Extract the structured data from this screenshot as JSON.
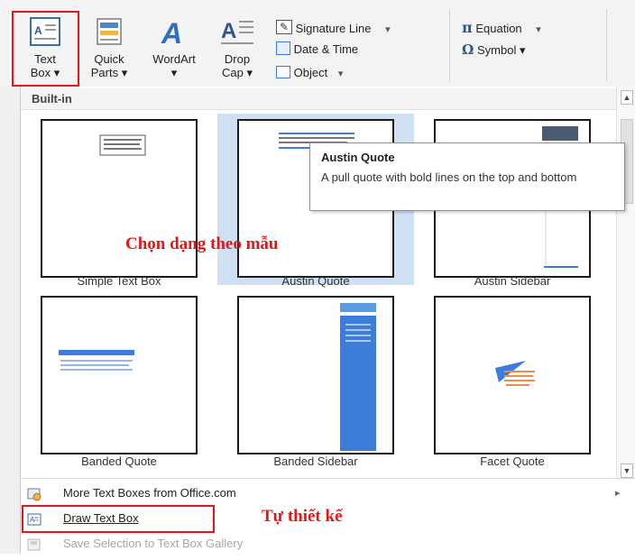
{
  "ribbon": {
    "text_box": {
      "line1": "Text",
      "line2": "Box ▾"
    },
    "quick_parts": {
      "line1": "Quick",
      "line2": "Parts ▾"
    },
    "wordart": {
      "line1": "WordArt",
      "line2": "▾"
    },
    "drop_cap": {
      "line1": "Drop",
      "line2": "Cap ▾"
    },
    "signature_line": "Signature Line",
    "date_time": "Date & Time",
    "object": "Object",
    "equation": "Equation",
    "symbol": "Symbol ▾",
    "dropdown_arrow": "▾",
    "equation_glyph": "π",
    "symbol_glyph": "Ω"
  },
  "gallery": {
    "section_title": "Built-in",
    "items": [
      {
        "label": "Simple Text Box"
      },
      {
        "label": "Austin Quote"
      },
      {
        "label": "Austin Sidebar"
      },
      {
        "label": "Banded Quote"
      },
      {
        "label": "Banded Sidebar"
      },
      {
        "label": "Facet Quote"
      }
    ]
  },
  "tooltip": {
    "title": "Austin Quote",
    "description": "A pull quote with bold lines on the top and bottom"
  },
  "annotations": {
    "template_hint": "Chọn dạng theo mẫu",
    "custom_hint": "Tự thiết kế"
  },
  "menu": {
    "more": "More Text Boxes from Office.com",
    "draw": "Draw Text Box",
    "save": "Save Selection to Text Box Gallery",
    "more_arrow": "▸"
  },
  "colors": {
    "highlight_red": "#e8131b",
    "selected_bg": "#cfe0f2",
    "accent_blue": "#3b7dd8",
    "accent_orange": "#f08a4b"
  }
}
